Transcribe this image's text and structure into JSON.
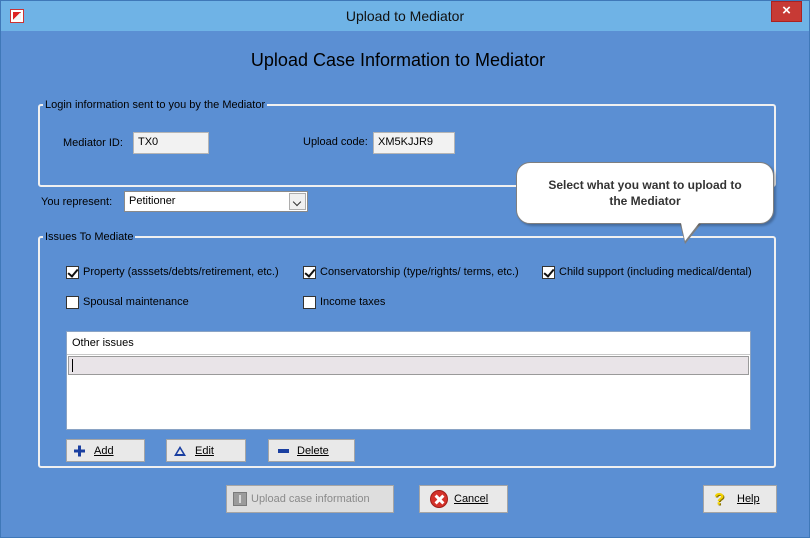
{
  "window": {
    "title": "Upload to Mediator",
    "close_symbol": "×"
  },
  "heading": "Upload Case Information to Mediator",
  "login": {
    "legend": "Login information sent to you by the Mediator",
    "mediator_id_label": "Mediator ID:",
    "mediator_id_value": "TX0",
    "upload_code_label": "Upload code:",
    "upload_code_value": "XM5KJJR9"
  },
  "represent": {
    "label": "You represent:",
    "selected": "Petitioner"
  },
  "callout": {
    "line1": "Select what you want to upload to",
    "line2": "the Mediator"
  },
  "issues": {
    "legend": "Issues To Mediate",
    "checkboxes": [
      {
        "label": "Property (asssets/debts/retirement, etc.)",
        "checked": true
      },
      {
        "label": "Conservatorship (type/rights/ terms, etc.)",
        "checked": true
      },
      {
        "label": "Child support (including medical/dental)",
        "checked": true
      },
      {
        "label": "Spousal maintenance",
        "checked": false
      },
      {
        "label": "Income taxes",
        "checked": false
      }
    ],
    "grid_header": "Other issues",
    "grid_row_value": "",
    "buttons": {
      "add": "Add",
      "edit": "Edit",
      "delete": "Delete"
    }
  },
  "footer": {
    "upload": "Upload case information",
    "cancel": "Cancel",
    "help": "Help"
  },
  "icons": {
    "add": "plus-icon",
    "edit": "triangle-icon",
    "delete": "minus-icon",
    "upload": "upload-icon",
    "cancel": "cancel-icon",
    "help": "help-icon"
  },
  "colors": {
    "window_bg": "#5b8fd3",
    "titlebar": "#6fb3e6",
    "close": "#c73a35"
  }
}
